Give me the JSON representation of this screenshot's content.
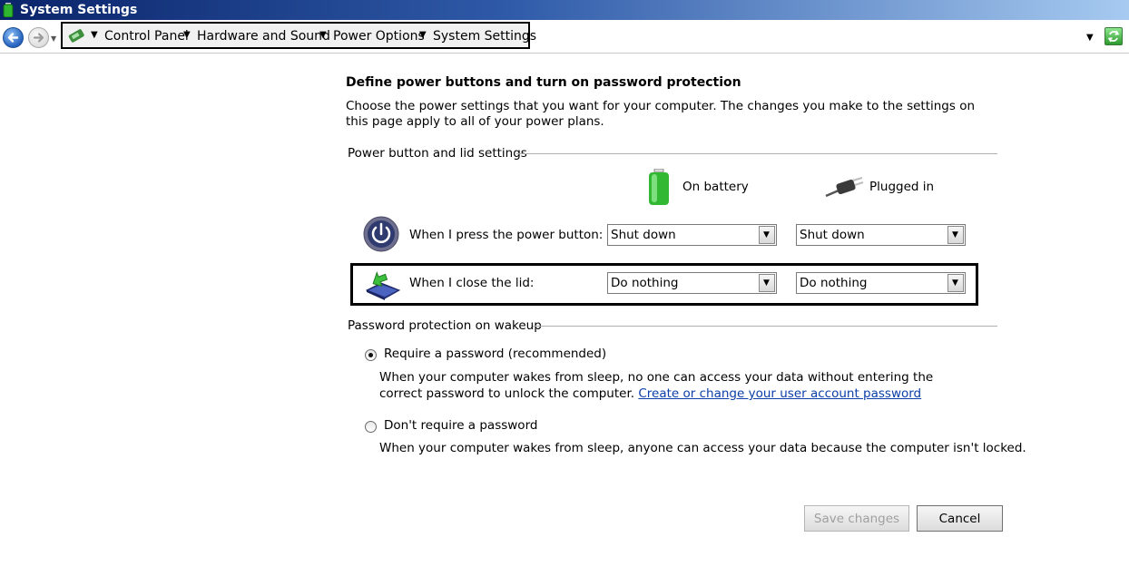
{
  "window": {
    "title": "System Settings"
  },
  "breadcrumb": [
    "Control Panel",
    "Hardware and Sound",
    "Power Options",
    "System Settings"
  ],
  "page": {
    "heading": "Define power buttons and turn on password protection",
    "intro": "Choose the power settings that you want for your computer. The changes you make to the settings on this page apply to all of your power plans."
  },
  "power_group": {
    "label": "Power button and lid settings",
    "columns": {
      "battery": "On battery",
      "plugged": "Plugged in"
    },
    "rows": [
      {
        "label": "When I press the power button:",
        "battery": "Shut down",
        "plugged": "Shut down"
      },
      {
        "label": "When I close the lid:",
        "battery": "Do nothing",
        "plugged": "Do nothing"
      }
    ]
  },
  "password_group": {
    "label": "Password protection on wakeup",
    "options": [
      {
        "label": "Require a password (recommended)",
        "selected": true,
        "desc": "When your computer wakes from sleep, no one can access your data without entering the correct password to unlock the computer.",
        "link": "Create or change your user account password"
      },
      {
        "label": "Don't require a password",
        "selected": false,
        "desc": "When your computer wakes from sleep, anyone can access your data because the computer isn't locked."
      }
    ]
  },
  "buttons": {
    "save": "Save changes",
    "cancel": "Cancel"
  },
  "colors": {
    "title_bar": "#0a246a",
    "link": "#0b3ea8",
    "highlight_border": "#000000"
  }
}
